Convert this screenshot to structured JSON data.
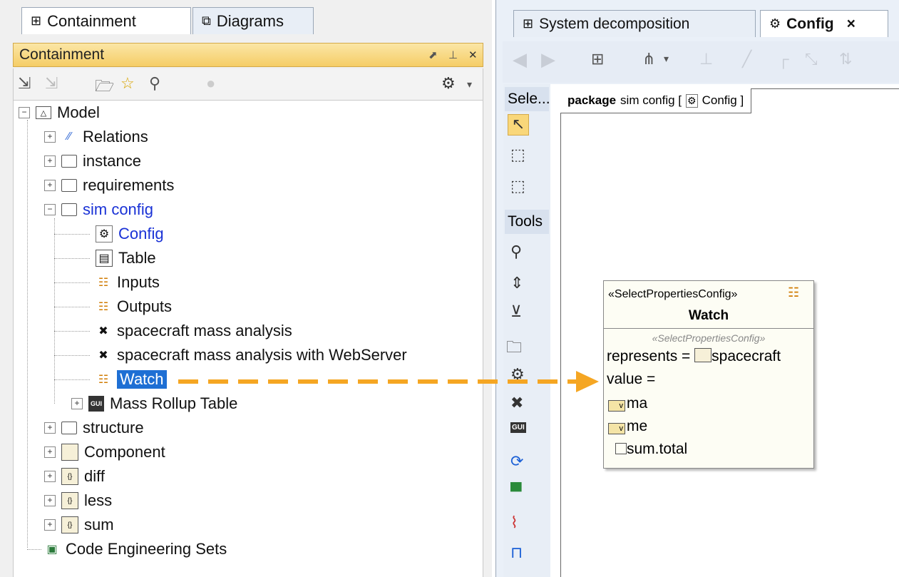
{
  "left_tabs": {
    "containment": "Containment",
    "diagrams": "Diagrams"
  },
  "panel_title": "Containment",
  "tree": {
    "model": "Model",
    "relations": "Relations",
    "instance": "instance",
    "requirements": "requirements",
    "sim_config": "sim config",
    "config": "Config",
    "table": "Table",
    "inputs": "Inputs",
    "outputs": "Outputs",
    "sma": "spacecraft mass analysis",
    "sma_web": "spacecraft mass analysis with WebServer",
    "watch": "Watch",
    "mass_rollup": "Mass Rollup Table",
    "structure": "structure",
    "component": "Component",
    "diff": "diff",
    "less": "less",
    "sum": "sum",
    "code_sets": "Code Engineering Sets"
  },
  "right_tabs": {
    "system": "System decomposition",
    "config": "Config",
    "close": "×"
  },
  "palette": {
    "selection": "Sele...",
    "tools": "Tools"
  },
  "diagram": {
    "keyword": "package",
    "name": "sim config [",
    "config": "Config ]"
  },
  "node": {
    "stereotype": "«SelectPropertiesConfig»",
    "name": "Watch",
    "sub_stereotype": "«SelectPropertiesConfig»",
    "represents_label": "represents =",
    "represents_value": "spacecraft",
    "value_label": "value =",
    "props": [
      "ma",
      "me",
      "sum.total"
    ],
    "v_mark": "v"
  },
  "colors": {
    "selection": "#1e6fd4",
    "arrow": "#f5a623",
    "header": "#f5cd66"
  }
}
